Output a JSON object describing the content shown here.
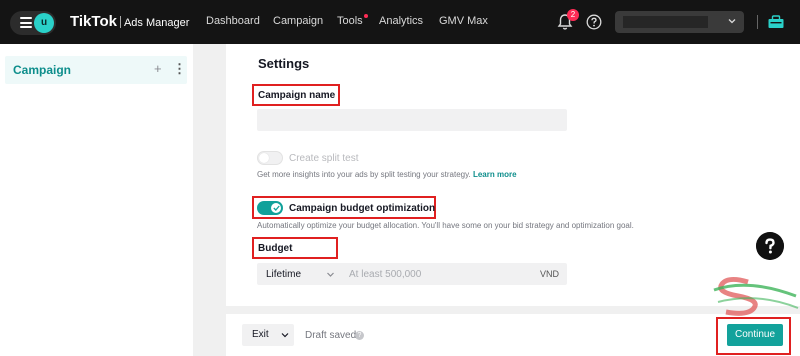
{
  "topbar": {
    "avatar_letter": "u",
    "brand": "TikTok",
    "product": "Ads Manager",
    "nav": [
      {
        "label": "Dashboard"
      },
      {
        "label": "Campaign"
      },
      {
        "label": "Tools"
      },
      {
        "label": "Analytics"
      },
      {
        "label": "GMV Max"
      }
    ],
    "notification_count": "2"
  },
  "sidebar": {
    "items": [
      {
        "label": "Campaign",
        "add": "+",
        "more": "⋮"
      }
    ]
  },
  "settings": {
    "title": "Settings",
    "campaign_name": {
      "label": "Campaign name",
      "value": ""
    },
    "split_test": {
      "label": "Create split test",
      "enabled": false,
      "hint": "Get more insights into your ads by split testing your strategy.",
      "link": "Learn more"
    },
    "cbo": {
      "label": "Campaign budget optimization",
      "enabled": true,
      "hint": "Automatically optimize your budget allocation. You'll have some on your bid strategy and optimization goal."
    },
    "budget": {
      "label": "Budget",
      "type": "Lifetime",
      "placeholder": "At least 500,000",
      "currency": "VND"
    }
  },
  "footer": {
    "exit_label": "Exit",
    "draft_status": "Draft saved",
    "continue_label": "Continue"
  },
  "colors": {
    "accent": "#13a29b",
    "highlight_box": "#e02020",
    "topbar_bg": "#141414"
  }
}
